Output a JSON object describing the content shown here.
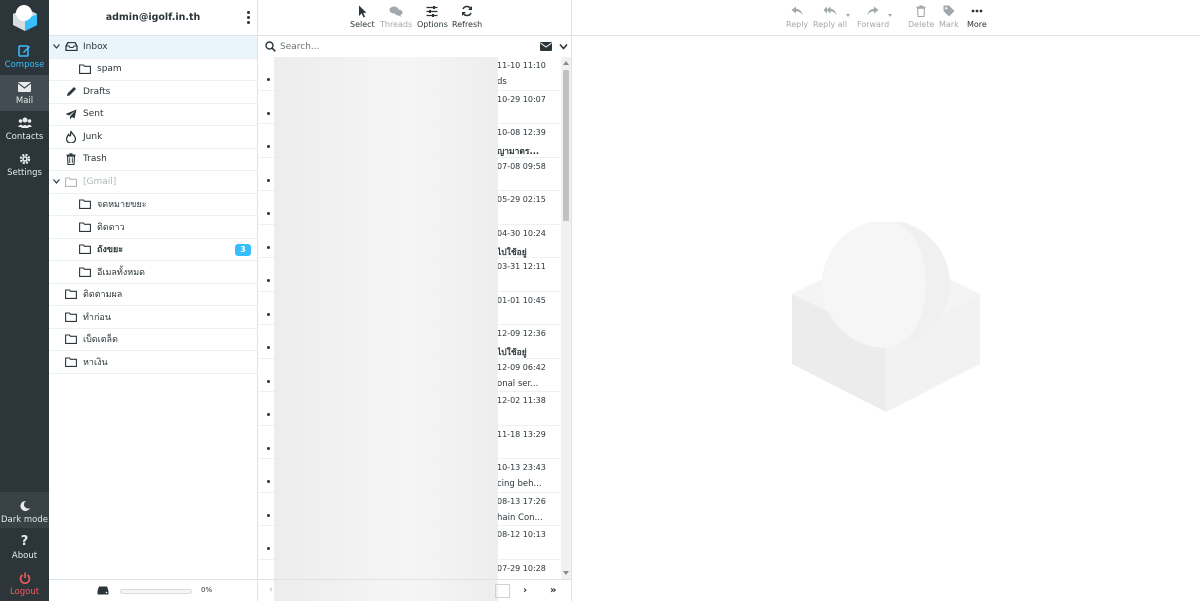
{
  "rail": {
    "compose": "Compose",
    "mail": "Mail",
    "contacts": "Contacts",
    "settings": "Settings",
    "dark_mode": "Dark mode",
    "about": "About",
    "logout": "Logout"
  },
  "account": {
    "email": "admin@igolf.in.th"
  },
  "folders": [
    {
      "name": "Inbox",
      "icon": "inbox-icon",
      "selected": true
    },
    {
      "name": "spam",
      "icon": "folder-icon"
    },
    {
      "name": "Drafts",
      "icon": "pencil-icon"
    },
    {
      "name": "Sent",
      "icon": "paper-plane-icon"
    },
    {
      "name": "Junk",
      "icon": "fire-icon"
    },
    {
      "name": "Trash",
      "icon": "trash-icon"
    },
    {
      "name": "[Gmail]",
      "icon": "folder-icon",
      "muted": true
    },
    {
      "name": "จดหมายขยะ",
      "icon": "folder-icon"
    },
    {
      "name": "ติดดาว",
      "icon": "folder-icon"
    },
    {
      "name": "ถังขยะ",
      "icon": "folder-icon",
      "unread": "3"
    },
    {
      "name": "อีเมลทั้งหมด",
      "icon": "folder-icon"
    },
    {
      "name": "ติดตามผล",
      "icon": "folder-icon"
    },
    {
      "name": "ทำก่อน",
      "icon": "folder-icon"
    },
    {
      "name": "เบ็ดเตล็ด",
      "icon": "folder-icon"
    },
    {
      "name": "หาเงิน",
      "icon": "folder-icon"
    }
  ],
  "quota": {
    "percent_text": "0%",
    "used_fraction": 0
  },
  "list_toolbar": {
    "select": "Select",
    "threads": "Threads",
    "options": "Options",
    "refresh": "Refresh"
  },
  "search": {
    "placeholder": "Search..."
  },
  "messages": [
    {
      "date": "11-10 11:10",
      "subject": "ds",
      "bold": false
    },
    {
      "date": "10-29 10:07",
      "subject": "",
      "bold": false
    },
    {
      "date": "10-08 12:39",
      "subject": "ญามาตร...",
      "bold": true
    },
    {
      "date": "07-08 09:58",
      "subject": "",
      "bold": false
    },
    {
      "date": "05-29 02:15",
      "subject": "",
      "bold": false
    },
    {
      "date": "04-30 10:24",
      "subject": "ไปใช้อยู่",
      "bold": true
    },
    {
      "date": "03-31 12:11",
      "subject": "",
      "bold": false
    },
    {
      "date": "01-01 10:45",
      "subject": "",
      "bold": false
    },
    {
      "date": "12-09 12:36",
      "subject": "ไปใช้อยู่",
      "bold": true
    },
    {
      "date": "12-09 06:42",
      "subject": "onal ser...",
      "bold": false
    },
    {
      "date": "12-02 11:38",
      "subject": "",
      "bold": false
    },
    {
      "date": "11-18 13:29",
      "subject": "",
      "bold": false
    },
    {
      "date": "10-13 23:43",
      "subject": "cing beh...",
      "bold": false
    },
    {
      "date": "08-13 17:26",
      "subject": "hain Con...",
      "bold": false
    },
    {
      "date": "08-12 10:13",
      "subject": "",
      "bold": false
    },
    {
      "date": "07-29 10:28",
      "subject": "",
      "bold": false
    }
  ],
  "preview_toolbar": {
    "reply": "Reply",
    "reply_all": "Reply all",
    "forward": "Forward",
    "delete": "Delete",
    "mark": "Mark",
    "more": "More"
  },
  "colors": {
    "rail_bg": "#2c363a",
    "accent": "#37beff",
    "logout": "#f45b5b",
    "selected_row": "#e9f4fb"
  }
}
